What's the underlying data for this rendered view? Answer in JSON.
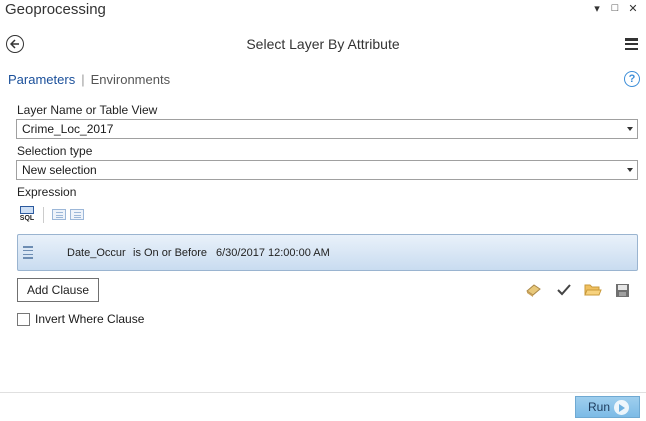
{
  "window": {
    "title": "Geoprocessing",
    "controls": [
      "▾",
      "□",
      "✕"
    ]
  },
  "tool": {
    "title": "Select Layer By Attribute"
  },
  "tabs": {
    "parameters": "Parameters",
    "environments": "Environments"
  },
  "layer": {
    "label": "Layer Name or Table View",
    "value": "Crime_Loc_2017"
  },
  "selection_type": {
    "label": "Selection type",
    "value": "New selection"
  },
  "expression": {
    "label": "Expression",
    "sql_icon_text": "SQL",
    "clause": {
      "field": "Date_Occur",
      "operator": "is On or Before",
      "value": "6/30/2017 12:00:00 AM"
    }
  },
  "add_clause_label": "Add Clause",
  "invert_label": "Invert Where Clause",
  "invert_checked": false,
  "run_label": "Run",
  "colors": {
    "accent": "#1a4f9a",
    "run_button": "#8ec6eb",
    "help": "#3d8ed8"
  },
  "icons": [
    "back-arrow-icon",
    "hamburger-menu-icon",
    "help-icon",
    "sql-icon",
    "indent-decrease-icon",
    "indent-increase-icon",
    "eraser-icon",
    "checkmark-icon",
    "folder-open-icon",
    "save-icon",
    "play-icon"
  ]
}
